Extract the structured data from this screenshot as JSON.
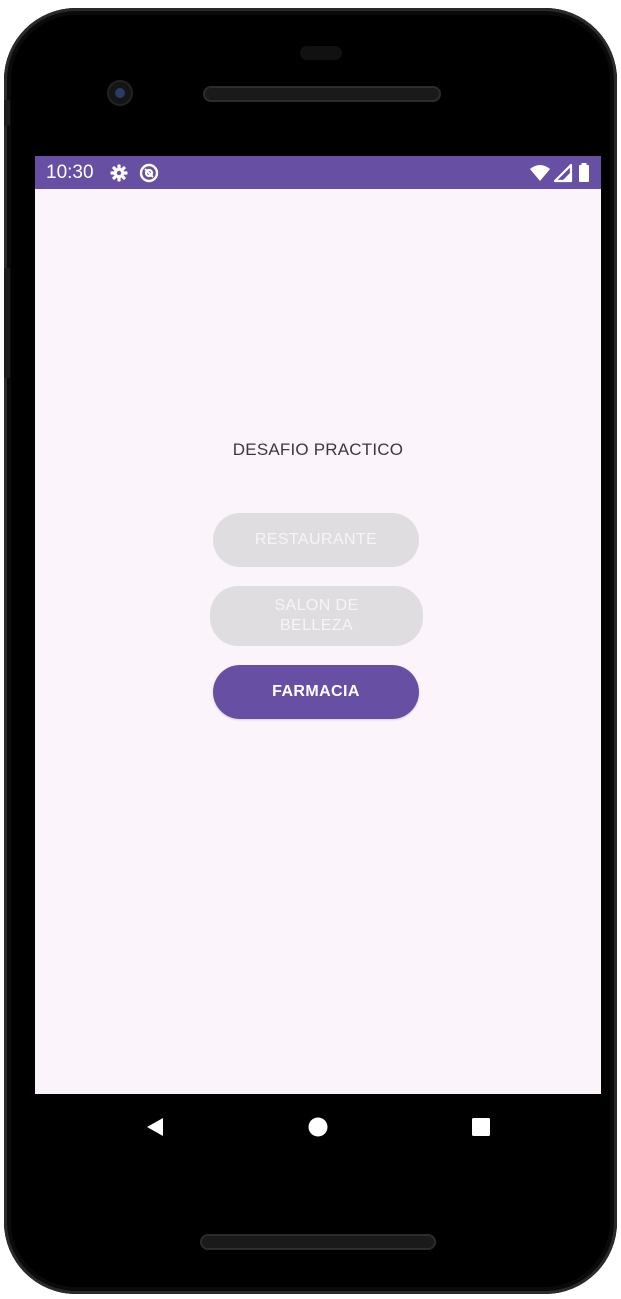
{
  "status_bar": {
    "time": "10:30",
    "left_icons": [
      "gear-icon",
      "at-sign-icon"
    ],
    "right_icons": [
      "wifi-icon",
      "signal-icon",
      "battery-icon"
    ],
    "color": "#6750a4"
  },
  "screen": {
    "title": "DESAFIO PRACTICO",
    "buttons": [
      {
        "label": "RESTAURANTE",
        "enabled": false
      },
      {
        "label": "SALON DE BELLEZA",
        "enabled": false
      },
      {
        "label": "FARMACIA",
        "enabled": true
      }
    ],
    "accent_color": "#6750a4",
    "background_color": "#fbf4fb"
  },
  "nav_bar": {
    "items": [
      "back-triangle-icon",
      "home-circle-icon",
      "recents-square-icon"
    ]
  }
}
